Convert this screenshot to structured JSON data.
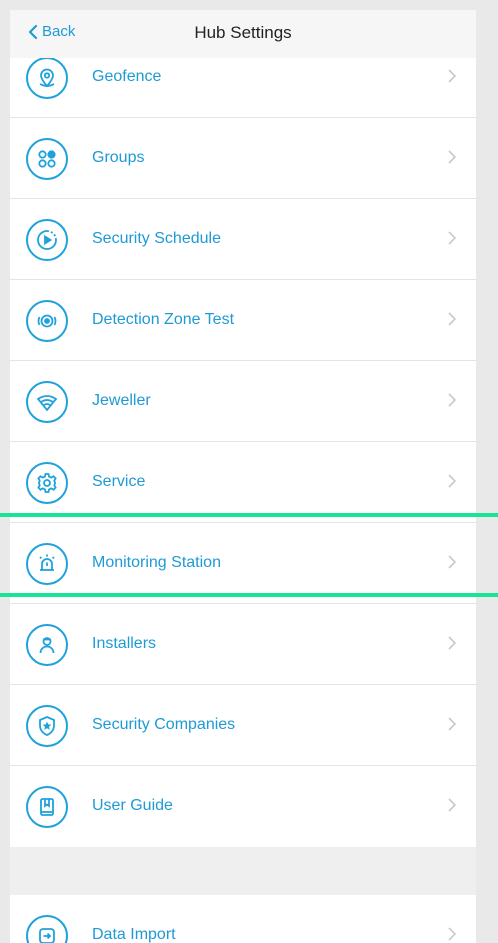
{
  "nav": {
    "back_label": "Back",
    "title": "Hub Settings"
  },
  "menu": {
    "items": [
      {
        "label": "Geofence",
        "icon": "geofence-icon"
      },
      {
        "label": "Groups",
        "icon": "groups-icon"
      },
      {
        "label": "Security Schedule",
        "icon": "schedule-icon"
      },
      {
        "label": "Detection Zone Test",
        "icon": "detection-zone-icon"
      },
      {
        "label": "Jeweller",
        "icon": "jeweller-icon"
      },
      {
        "label": "Service",
        "icon": "gear-icon"
      },
      {
        "label": "Monitoring Station",
        "icon": "siren-icon"
      },
      {
        "label": "Installers",
        "icon": "installer-icon"
      },
      {
        "label": "Security Companies",
        "icon": "shield-star-icon"
      },
      {
        "label": "User Guide",
        "icon": "book-icon"
      }
    ],
    "extra_items": [
      {
        "label": "Data Import",
        "icon": "import-icon"
      }
    ]
  },
  "highlight": {
    "item": "Monitoring Station",
    "color": "#16e49b"
  },
  "colors": {
    "accent": "#1fa2dc",
    "label": "#1e9ad5",
    "chevron": "#c9c9c9"
  }
}
